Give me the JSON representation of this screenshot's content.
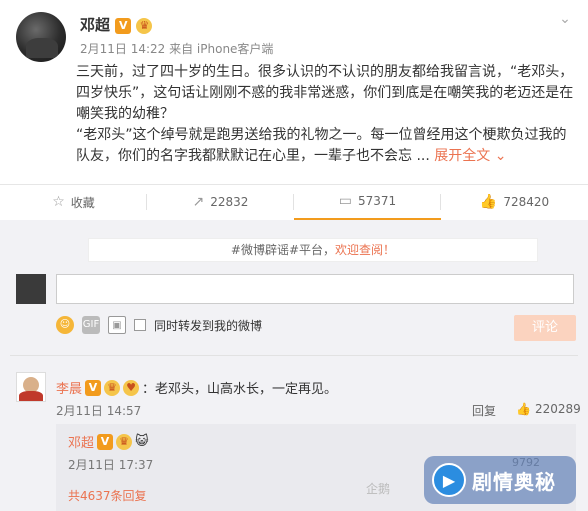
{
  "post": {
    "author": "邓超",
    "meta": "2月11日 14:22 来自 iPhone客户端",
    "paragraph1": "三天前，过了四十岁的生日。很多认识的不认识的朋友都给我留言说，“老邓头，四岁快乐”，这句话让刚刚不惑的我非常迷惑，你们到底是在嘲笑我的老迈还是在嘲笑我的幼稚？",
    "paragraph2": "“老邓头”这个绰号就是跑男送给我的礼物之一。每一位曾经用这个梗欺负过我的队友，你们的名字我都默默记在心里，一辈子也不会忘 ...",
    "expand": "展开全文",
    "expand_icon": "⌄"
  },
  "actions": {
    "favorite": "收藏",
    "forward_count": "22832",
    "comment_count": "57371",
    "like_count": "728420"
  },
  "notice": {
    "prefix": "#微博辟谣#平台，",
    "link": "欢迎查阅！"
  },
  "composer": {
    "checkbox_label": "同时转发到我的微博",
    "submit": "评论"
  },
  "comment": {
    "author": "李晨",
    "text": "：老邓头，山高水长，一定再见。",
    "date": "2月11日 14:57",
    "reply": "回复",
    "likes": "220289"
  },
  "sub_comment": {
    "author": "邓超",
    "date": "2月11日 17:37",
    "likes": "9792",
    "more": "共4637条回复",
    "emoji": "😺"
  },
  "watermark": {
    "text": "剧情奥秘",
    "ghost": "企鹅"
  },
  "colors": {
    "accent": "#eb7350",
    "verified": "#f29b1d",
    "background": "#f2f2f5"
  },
  "icons": {
    "star": "☆",
    "forward": "↗",
    "comment": "▭",
    "like": "👍",
    "chevron": "⌄"
  }
}
